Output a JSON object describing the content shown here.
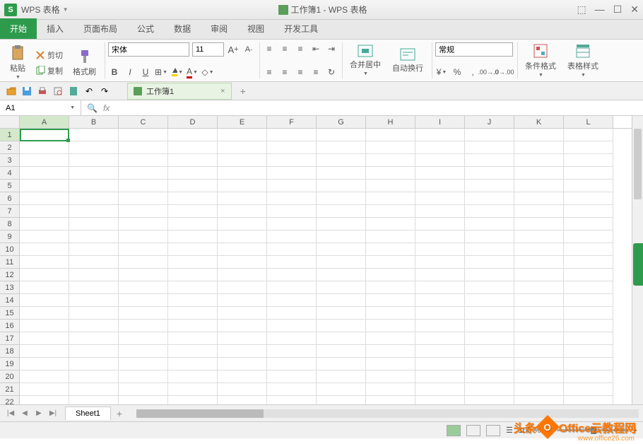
{
  "app": {
    "name": "WPS 表格",
    "title": "工作簿1 - WPS 表格"
  },
  "tabs": [
    "开始",
    "插入",
    "页面布局",
    "公式",
    "数据",
    "审阅",
    "视图",
    "开发工具"
  ],
  "active_tab": 0,
  "ribbon": {
    "paste": "粘贴",
    "cut": "剪切",
    "copy": "复制",
    "format_painter": "格式刷",
    "font_name": "宋体",
    "font_size": "11",
    "merge_center": "合并居中",
    "wrap_text": "自动换行",
    "number_format": "常规",
    "conditional_format": "条件格式",
    "table_style": "表格样式"
  },
  "doc_tab": "工作簿1",
  "cell_ref": "A1",
  "columns": [
    "A",
    "B",
    "C",
    "D",
    "E",
    "F",
    "G",
    "H",
    "I",
    "J",
    "K",
    "L"
  ],
  "rows": [
    "1",
    "2",
    "3",
    "4",
    "5",
    "6",
    "7",
    "8",
    "9",
    "10",
    "11",
    "12",
    "13",
    "14",
    "15",
    "16",
    "17",
    "18",
    "19",
    "20",
    "21",
    "22"
  ],
  "sheet_name": "Sheet1",
  "zoom": "100 %",
  "watermark": {
    "text1": "头条",
    "text2": "Office云教程网",
    "url": "www.office26.com"
  }
}
